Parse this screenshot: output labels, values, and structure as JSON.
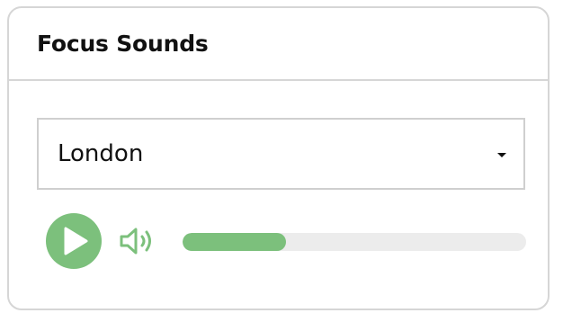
{
  "card": {
    "title": "Focus Sounds"
  },
  "sound_select": {
    "selected_value": "London"
  },
  "player": {
    "play_icon": "play-icon",
    "volume_icon": "volume-icon",
    "progress_fraction": 0.3
  },
  "colors": {
    "accent": "#7cc07c",
    "track": "#ececec",
    "border": "#d6d6d6"
  }
}
